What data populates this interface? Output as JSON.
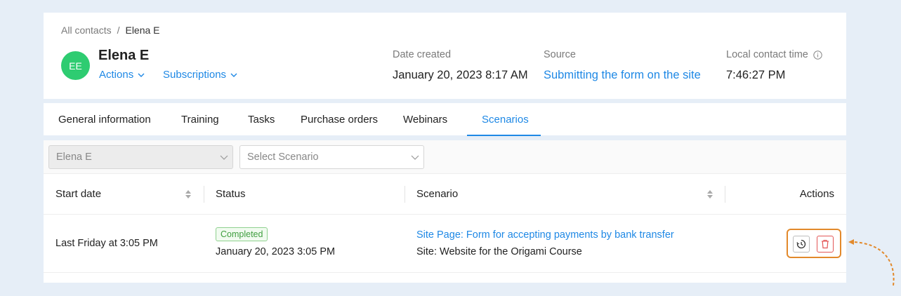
{
  "breadcrumb": {
    "parent": "All contacts",
    "separator": "/",
    "current": "Elena E"
  },
  "contact": {
    "initials": "EE",
    "name": "Elena E",
    "avatar_color": "#2ecc71",
    "actions_label": "Actions",
    "subscriptions_label": "Subscriptions"
  },
  "meta": {
    "date_created_label": "Date created",
    "date_created_value": "January 20, 2023 8:17 AM",
    "source_label": "Source",
    "source_value": "Submitting the form on the site",
    "local_time_label": "Local contact time",
    "local_time_value": "7:46:27 PM"
  },
  "tabs": [
    {
      "label": "General information",
      "active": false
    },
    {
      "label": "Training",
      "active": false
    },
    {
      "label": "Tasks",
      "active": false
    },
    {
      "label": "Purchase orders",
      "active": false
    },
    {
      "label": "Webinars",
      "active": false
    },
    {
      "label": "Scenarios",
      "active": true
    }
  ],
  "filters": {
    "contact_select_value": "Elena E",
    "scenario_select_placeholder": "Select Scenario"
  },
  "table": {
    "columns": [
      "Start date",
      "Status",
      "Scenario",
      "Actions"
    ],
    "rows": [
      {
        "start_date": "Last Friday at 3:05 PM",
        "status_badge": "Completed",
        "status_date": "January 20, 2023 3:05 PM",
        "scenario_link": "Site Page: Form for accepting payments by bank transfer",
        "scenario_site": "Site: Website for the Origami Course"
      }
    ]
  },
  "colors": {
    "accent": "#1e88e5",
    "success": "#3f9e3f",
    "danger": "#e35656",
    "highlight": "#e2892b",
    "background": "#e6eef7"
  },
  "icons": {
    "actions_chevron": "chevron-down-icon",
    "info": "info-icon",
    "sort": "sort-icon",
    "history": "history-icon",
    "delete": "trash-icon",
    "pointer": "dashed-arrow-icon"
  }
}
